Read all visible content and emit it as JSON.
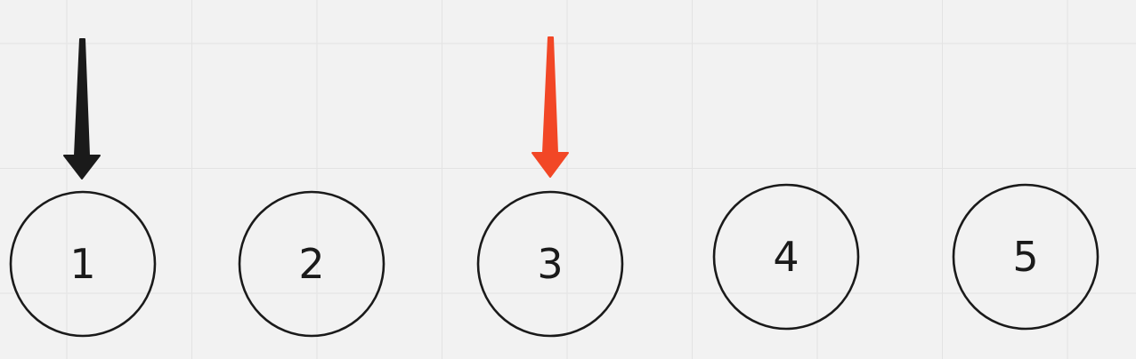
{
  "canvas": {
    "background": "#f2f2f2",
    "grid_color": "#e3e3e3",
    "grid": true
  },
  "nodes": [
    {
      "label": "1"
    },
    {
      "label": "2"
    },
    {
      "label": "3"
    },
    {
      "label": "4"
    },
    {
      "label": "5"
    }
  ],
  "arrows": [
    {
      "target": "1",
      "color": "#1a1a1a",
      "icon": "down-arrow-icon"
    },
    {
      "target": "3",
      "color": "#f24726",
      "icon": "down-arrow-icon"
    }
  ]
}
